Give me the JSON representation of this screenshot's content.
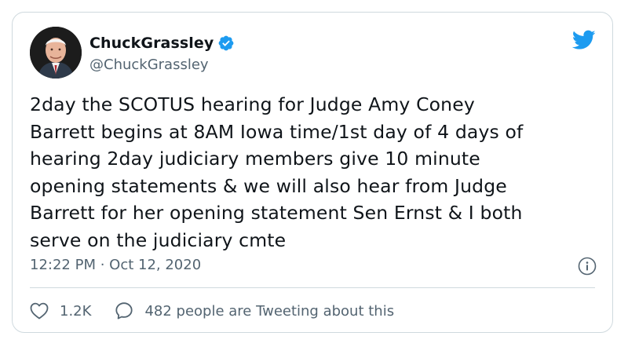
{
  "author": {
    "name": "ChuckGrassley",
    "handle": "@ChuckGrassley",
    "verified": true
  },
  "tweet": {
    "text": "2day the SCOTUS hearing for Judge Amy Coney\nBarrett begins at 8AM Iowa time/1st day of 4 days of\nhearing 2day judiciary members give 10 minute\nopening statements & we will also hear from Judge\nBarrett for her opening statement Sen Ernst & I both\nserve on the judiciary cmte",
    "timestamp": "12:22 PM · Oct 12, 2020"
  },
  "actions": {
    "likes": "1.2K",
    "conversation": "482 people are Tweeting about this"
  },
  "icons": {
    "brand": "twitter-bird-icon",
    "verified": "verified-badge-icon",
    "info": "info-icon",
    "like": "heart-icon",
    "reply": "speech-bubble-icon"
  },
  "colors": {
    "brand_blue": "#1d9bf0",
    "text": "#0f1419",
    "secondary_text": "#536471",
    "border": "#cfd9de"
  }
}
